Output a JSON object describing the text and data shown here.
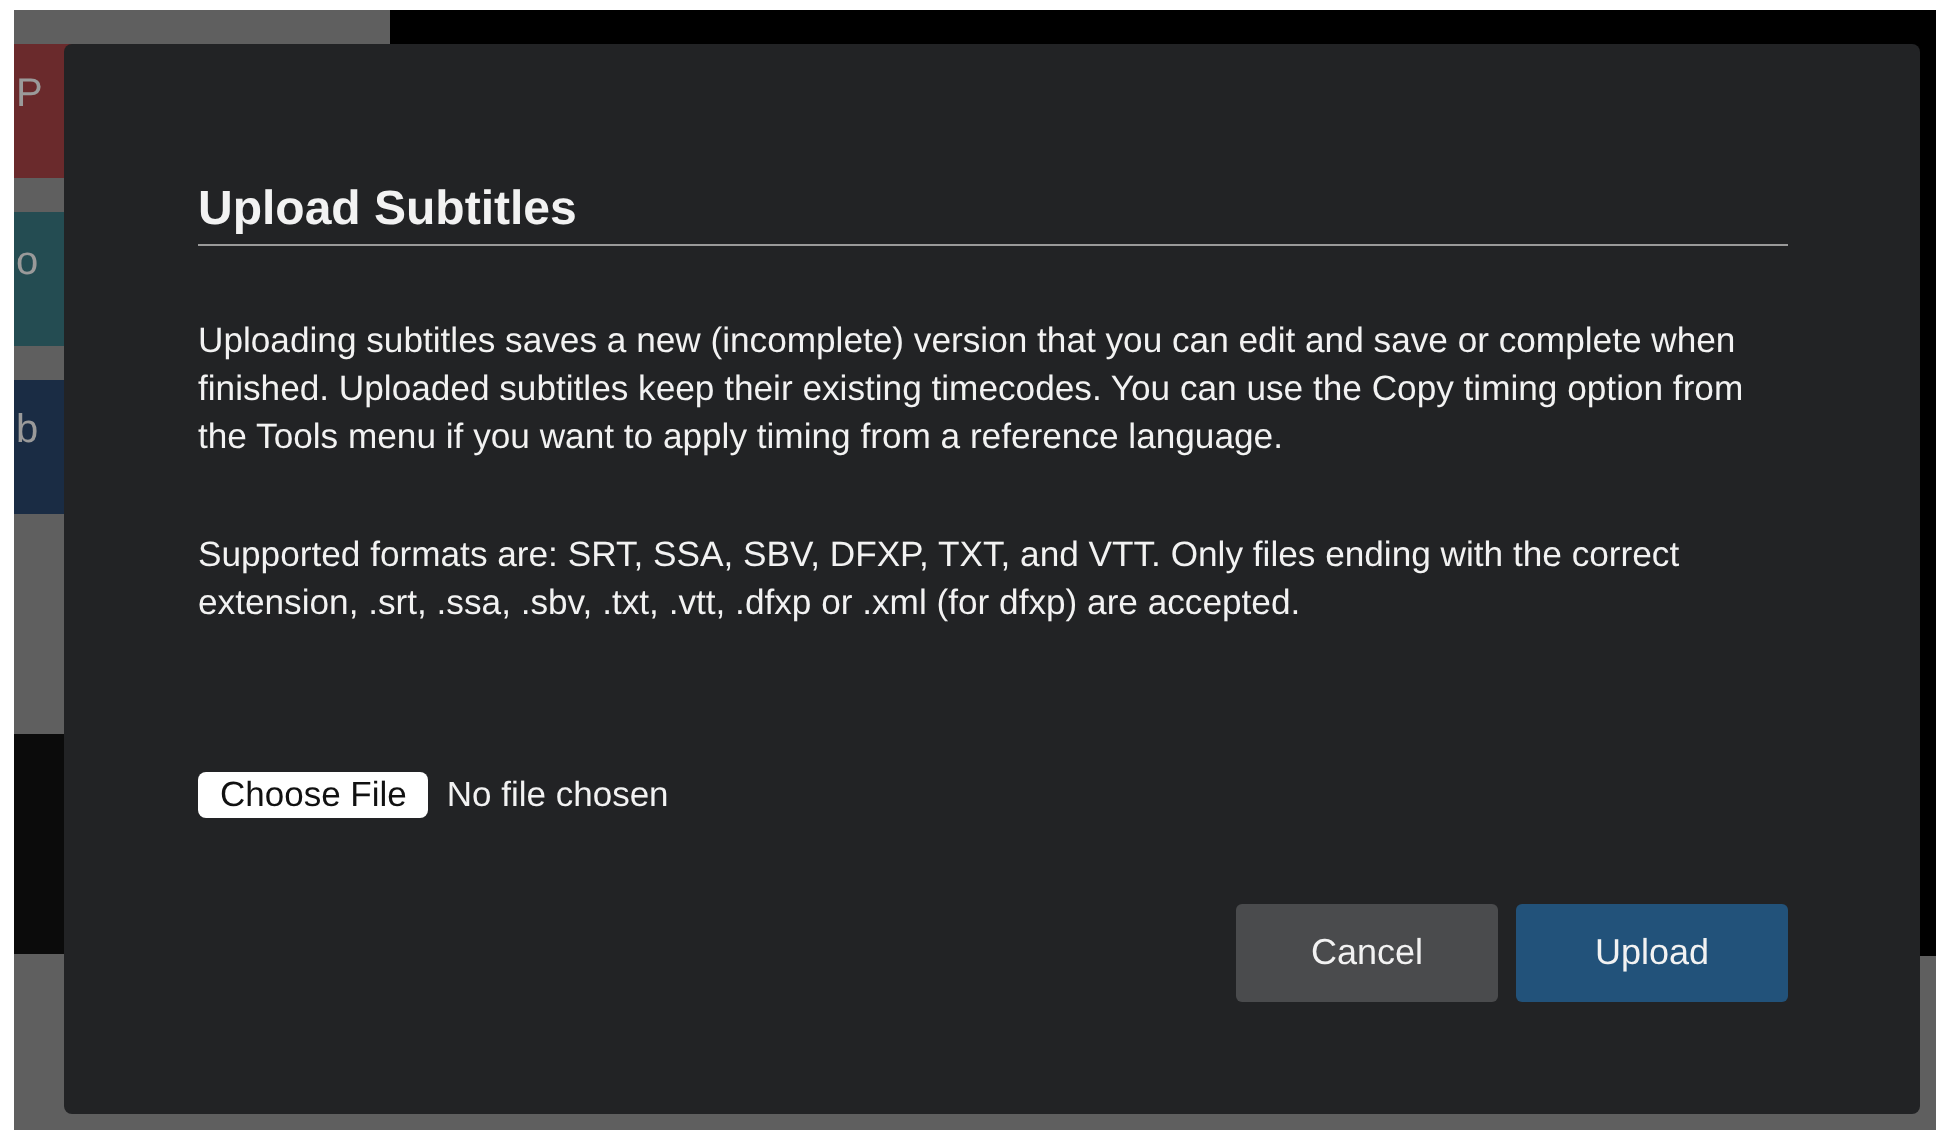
{
  "background": {
    "blocks": [
      {
        "label": "P",
        "color": "#6a2a2c"
      },
      {
        "label": "o",
        "color": "#244c52"
      },
      {
        "label": "b",
        "color": "#1a2c44"
      }
    ]
  },
  "dialog": {
    "title": "Upload Subtitles",
    "paragraphs": [
      "Uploading subtitles saves a new (incomplete) version that you can edit and save or complete when finished. Uploaded subtitles keep their existing timecodes. You can use the Copy timing option from the Tools menu if you want to apply timing from a reference language.",
      "Supported formats are: SRT, SSA, SBV, DFXP, TXT, and VTT. Only files ending with the correct extension, .srt, .ssa, .sbv, .txt, .vtt, .dfxp or .xml (for dfxp) are accepted."
    ],
    "file_input": {
      "button": "Choose File",
      "status": "No file chosen"
    },
    "buttons": [
      {
        "label": "Cancel",
        "kind": "secondary"
      },
      {
        "label": "Upload",
        "kind": "primary"
      }
    ]
  }
}
